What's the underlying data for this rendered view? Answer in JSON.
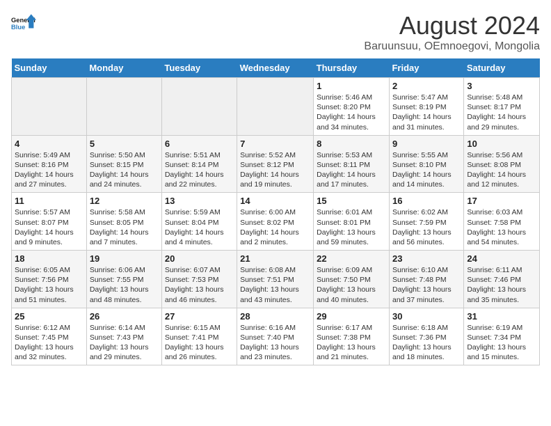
{
  "logo": {
    "line1": "General",
    "line2": "Blue"
  },
  "title": "August 2024",
  "subtitle": "Baruunsuu, OEmnoegovi, Mongolia",
  "days_of_week": [
    "Sunday",
    "Monday",
    "Tuesday",
    "Wednesday",
    "Thursday",
    "Friday",
    "Saturday"
  ],
  "weeks": [
    [
      {
        "day": "",
        "info": ""
      },
      {
        "day": "",
        "info": ""
      },
      {
        "day": "",
        "info": ""
      },
      {
        "day": "",
        "info": ""
      },
      {
        "day": "1",
        "info": "Sunrise: 5:46 AM\nSunset: 8:20 PM\nDaylight: 14 hours\nand 34 minutes."
      },
      {
        "day": "2",
        "info": "Sunrise: 5:47 AM\nSunset: 8:19 PM\nDaylight: 14 hours\nand 31 minutes."
      },
      {
        "day": "3",
        "info": "Sunrise: 5:48 AM\nSunset: 8:17 PM\nDaylight: 14 hours\nand 29 minutes."
      }
    ],
    [
      {
        "day": "4",
        "info": "Sunrise: 5:49 AM\nSunset: 8:16 PM\nDaylight: 14 hours\nand 27 minutes."
      },
      {
        "day": "5",
        "info": "Sunrise: 5:50 AM\nSunset: 8:15 PM\nDaylight: 14 hours\nand 24 minutes."
      },
      {
        "day": "6",
        "info": "Sunrise: 5:51 AM\nSunset: 8:14 PM\nDaylight: 14 hours\nand 22 minutes."
      },
      {
        "day": "7",
        "info": "Sunrise: 5:52 AM\nSunset: 8:12 PM\nDaylight: 14 hours\nand 19 minutes."
      },
      {
        "day": "8",
        "info": "Sunrise: 5:53 AM\nSunset: 8:11 PM\nDaylight: 14 hours\nand 17 minutes."
      },
      {
        "day": "9",
        "info": "Sunrise: 5:55 AM\nSunset: 8:10 PM\nDaylight: 14 hours\nand 14 minutes."
      },
      {
        "day": "10",
        "info": "Sunrise: 5:56 AM\nSunset: 8:08 PM\nDaylight: 14 hours\nand 12 minutes."
      }
    ],
    [
      {
        "day": "11",
        "info": "Sunrise: 5:57 AM\nSunset: 8:07 PM\nDaylight: 14 hours\nand 9 minutes."
      },
      {
        "day": "12",
        "info": "Sunrise: 5:58 AM\nSunset: 8:05 PM\nDaylight: 14 hours\nand 7 minutes."
      },
      {
        "day": "13",
        "info": "Sunrise: 5:59 AM\nSunset: 8:04 PM\nDaylight: 14 hours\nand 4 minutes."
      },
      {
        "day": "14",
        "info": "Sunrise: 6:00 AM\nSunset: 8:02 PM\nDaylight: 14 hours\nand 2 minutes."
      },
      {
        "day": "15",
        "info": "Sunrise: 6:01 AM\nSunset: 8:01 PM\nDaylight: 13 hours\nand 59 minutes."
      },
      {
        "day": "16",
        "info": "Sunrise: 6:02 AM\nSunset: 7:59 PM\nDaylight: 13 hours\nand 56 minutes."
      },
      {
        "day": "17",
        "info": "Sunrise: 6:03 AM\nSunset: 7:58 PM\nDaylight: 13 hours\nand 54 minutes."
      }
    ],
    [
      {
        "day": "18",
        "info": "Sunrise: 6:05 AM\nSunset: 7:56 PM\nDaylight: 13 hours\nand 51 minutes."
      },
      {
        "day": "19",
        "info": "Sunrise: 6:06 AM\nSunset: 7:55 PM\nDaylight: 13 hours\nand 48 minutes."
      },
      {
        "day": "20",
        "info": "Sunrise: 6:07 AM\nSunset: 7:53 PM\nDaylight: 13 hours\nand 46 minutes."
      },
      {
        "day": "21",
        "info": "Sunrise: 6:08 AM\nSunset: 7:51 PM\nDaylight: 13 hours\nand 43 minutes."
      },
      {
        "day": "22",
        "info": "Sunrise: 6:09 AM\nSunset: 7:50 PM\nDaylight: 13 hours\nand 40 minutes."
      },
      {
        "day": "23",
        "info": "Sunrise: 6:10 AM\nSunset: 7:48 PM\nDaylight: 13 hours\nand 37 minutes."
      },
      {
        "day": "24",
        "info": "Sunrise: 6:11 AM\nSunset: 7:46 PM\nDaylight: 13 hours\nand 35 minutes."
      }
    ],
    [
      {
        "day": "25",
        "info": "Sunrise: 6:12 AM\nSunset: 7:45 PM\nDaylight: 13 hours\nand 32 minutes."
      },
      {
        "day": "26",
        "info": "Sunrise: 6:14 AM\nSunset: 7:43 PM\nDaylight: 13 hours\nand 29 minutes."
      },
      {
        "day": "27",
        "info": "Sunrise: 6:15 AM\nSunset: 7:41 PM\nDaylight: 13 hours\nand 26 minutes."
      },
      {
        "day": "28",
        "info": "Sunrise: 6:16 AM\nSunset: 7:40 PM\nDaylight: 13 hours\nand 23 minutes."
      },
      {
        "day": "29",
        "info": "Sunrise: 6:17 AM\nSunset: 7:38 PM\nDaylight: 13 hours\nand 21 minutes."
      },
      {
        "day": "30",
        "info": "Sunrise: 6:18 AM\nSunset: 7:36 PM\nDaylight: 13 hours\nand 18 minutes."
      },
      {
        "day": "31",
        "info": "Sunrise: 6:19 AM\nSunset: 7:34 PM\nDaylight: 13 hours\nand 15 minutes."
      }
    ]
  ]
}
